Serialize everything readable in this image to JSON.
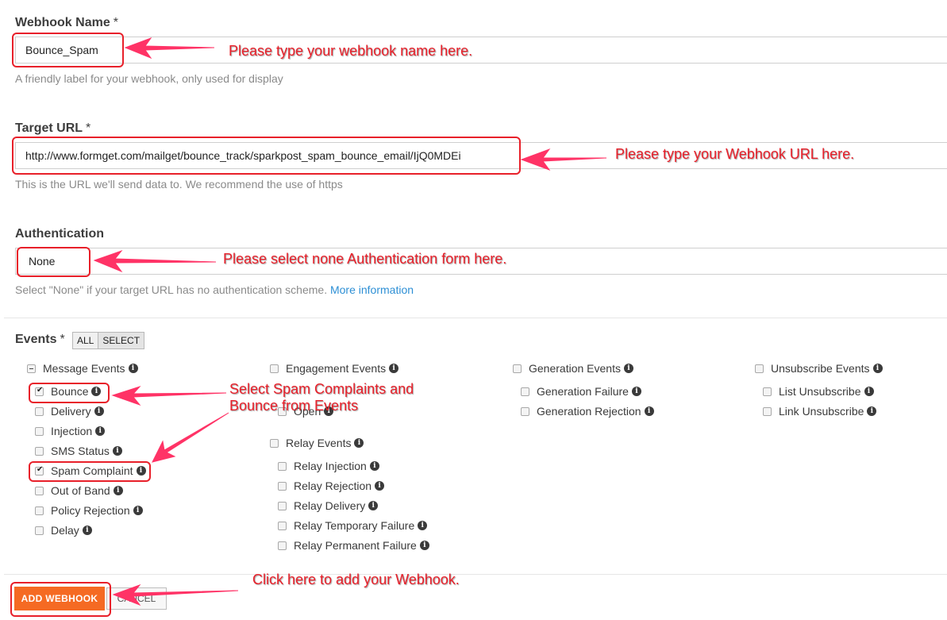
{
  "webhook_name": {
    "label": "Webhook Name",
    "required": "*",
    "value": "Bounce_Spam",
    "help": "A friendly label for your webhook, only used for display",
    "annotation": "Please type your webhook name here."
  },
  "target_url": {
    "label": "Target URL",
    "required": "*",
    "value": "http://www.formget.com/mailget/bounce_track/sparkpost_spam_bounce_email/IjQ0MDEi",
    "help": "This is the URL we'll send data to. We recommend the use of https",
    "annotation": "Please type your Webhook URL here."
  },
  "authentication": {
    "label": "Authentication",
    "value": "None",
    "help_prefix": "Select \"None\" if your target URL has no authentication scheme.",
    "help_link": "More information",
    "annotation": "Please select none Authentication form here."
  },
  "events": {
    "label": "Events",
    "required": "*",
    "all_label": "ALL",
    "select_label": "SELECT",
    "message_events": {
      "label": "Message Events",
      "items": [
        {
          "label": "Bounce",
          "checked": true
        },
        {
          "label": "Delivery",
          "checked": false
        },
        {
          "label": "Injection",
          "checked": false
        },
        {
          "label": "SMS Status",
          "checked": false
        },
        {
          "label": "Spam Complaint",
          "checked": true
        },
        {
          "label": "Out of Band",
          "checked": false
        },
        {
          "label": "Policy Rejection",
          "checked": false
        },
        {
          "label": "Delay",
          "checked": false
        }
      ]
    },
    "engagement_events": {
      "label": "Engagement Events",
      "items": [
        {
          "label": "Open",
          "checked": false
        }
      ]
    },
    "relay_events": {
      "label": "Relay Events",
      "items": [
        {
          "label": "Relay Injection",
          "checked": false
        },
        {
          "label": "Relay Rejection",
          "checked": false
        },
        {
          "label": "Relay Delivery",
          "checked": false
        },
        {
          "label": "Relay Temporary Failure",
          "checked": false
        },
        {
          "label": "Relay Permanent Failure",
          "checked": false
        }
      ]
    },
    "generation_events": {
      "label": "Generation Events",
      "items": [
        {
          "label": "Generation Failure",
          "checked": false
        },
        {
          "label": "Generation Rejection",
          "checked": false
        }
      ]
    },
    "unsubscribe_events": {
      "label": "Unsubscribe Events",
      "items": [
        {
          "label": "List Unsubscribe",
          "checked": false
        },
        {
          "label": "Link Unsubscribe",
          "checked": false
        }
      ]
    },
    "annotation": "Select Spam Complaints and\nBounce from Events"
  },
  "actions": {
    "add_label": "ADD WEBHOOK",
    "cancel_label": "CANCEL",
    "annotation": "Click here to add your Webhook."
  },
  "colors": {
    "accent": "#f56a23",
    "annotation": "#e8202a",
    "link": "#2d8fd5"
  },
  "icons": {
    "info": "info-circle-icon"
  }
}
